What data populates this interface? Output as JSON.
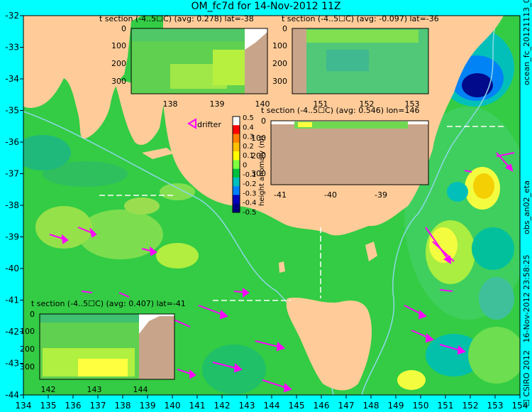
{
  "title": "OM_fc7d for 14-Nov-2012 11Z",
  "map": {
    "lon_ticks": [
      "134",
      "135",
      "136",
      "137",
      "138",
      "139",
      "140",
      "141",
      "142",
      "143",
      "144",
      "145",
      "146",
      "147",
      "148",
      "149",
      "150",
      "151",
      "152",
      "153",
      "154"
    ],
    "lat_ticks": [
      "-32",
      "-33",
      "-34",
      "-35",
      "-36",
      "-37",
      "-38",
      "-39",
      "-40",
      "-41",
      "-42",
      "-43",
      "-44"
    ]
  },
  "legend": {
    "drifter_label": "drifter",
    "colorbar_title": "height anomaly (m)",
    "colorbar_ticks": [
      "0.5",
      "0.4",
      "0.3",
      "0.2",
      "0.1",
      "0",
      "-0.1",
      "-0.2",
      "-0.3",
      "-0.4",
      "-0.5"
    ],
    "colors": [
      "#ffffff",
      "#ff0000",
      "#ff7f00",
      "#ffc000",
      "#ffff00",
      "#80ff40",
      "#00c040",
      "#00c0c0",
      "#0080ff",
      "#0000c0",
      "#000080"
    ]
  },
  "insets": [
    {
      "title": "t section (-4..5☐C) (avg: 0.278) lat=-38",
      "y_ticks": [
        "0",
        "100",
        "200",
        "300"
      ],
      "x_ticks": [
        "138",
        "139",
        "140"
      ]
    },
    {
      "title": "t section (-4..5☐C) (avg: -0.097) lat=-36",
      "y_ticks": [
        "0",
        "100",
        "200",
        "300"
      ],
      "x_ticks": [
        "151",
        "152",
        "153"
      ]
    },
    {
      "title": "t section (-4..5☐C) (avg: 0.546) lon=146",
      "y_ticks": [
        "0",
        "100",
        "200",
        "300"
      ],
      "x_ticks": [
        "-41",
        "-40",
        "-39"
      ]
    },
    {
      "title": "t section (-4..5☐C) (avg: 0.407) lat=-41",
      "y_ticks": [
        "0",
        "100",
        "200",
        "300"
      ],
      "x_ticks": [
        "142",
        "143",
        "144"
      ]
    }
  ],
  "side_text": {
    "run_id": "ocean_fc_20121113_024",
    "obs_id": "obs_an02_eta",
    "stamp": "16-Nov-2012 23:58:25",
    "copyright": "☐ CSIRO 2012"
  }
}
